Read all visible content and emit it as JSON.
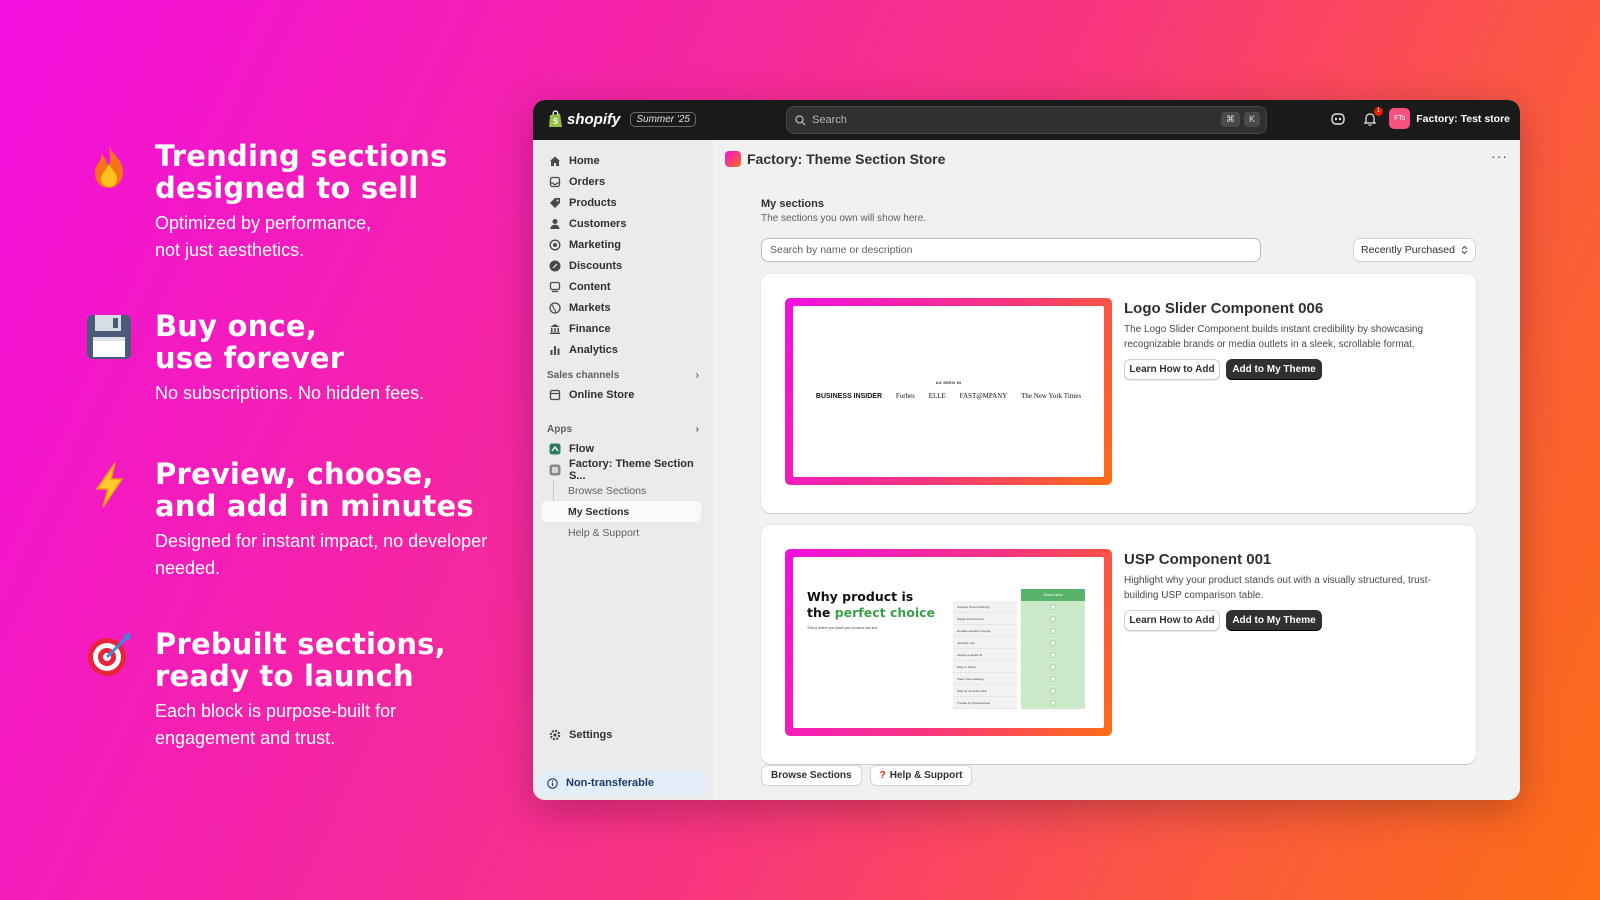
{
  "features": [
    {
      "icon": "fire-icon",
      "emoji": "🔥",
      "title_line1": "Trending sections",
      "title_line2": "designed to sell",
      "body_line1": "Optimized by performance,",
      "body_line2": "not just aesthetics."
    },
    {
      "icon": "floppy-disk-icon",
      "emoji": "💾",
      "title_line1": "Buy once,",
      "title_line2": "use forever",
      "body_line1": "No subscriptions. No hidden fees.",
      "body_line2": ""
    },
    {
      "icon": "lightning-icon",
      "emoji": "⚡",
      "title_line1": "Preview, choose,",
      "title_line2": "and add in minutes",
      "body_line1": "Designed for instant impact, no developer",
      "body_line2": "needed."
    },
    {
      "icon": "target-icon",
      "emoji": "🎯",
      "title_line1": "Prebuilt sections,",
      "title_line2": "ready to launch",
      "body_line1": "Each block is purpose-built for",
      "body_line2": "engagement and trust."
    }
  ],
  "topbar": {
    "brand": "shopify",
    "edition": "Summer '25",
    "search_placeholder": "Search",
    "shortcut_keys": [
      "⌘",
      "K"
    ],
    "notification_count": "1",
    "store_initials": "FTs",
    "store_name": "Factory: Test store"
  },
  "sidebar": {
    "items": [
      {
        "label": "Home",
        "icon": "home-icon"
      },
      {
        "label": "Orders",
        "icon": "inbox-icon"
      },
      {
        "label": "Products",
        "icon": "tag-icon"
      },
      {
        "label": "Customers",
        "icon": "person-icon"
      },
      {
        "label": "Marketing",
        "icon": "target-icon"
      },
      {
        "label": "Discounts",
        "icon": "discount-icon"
      },
      {
        "label": "Content",
        "icon": "content-icon"
      },
      {
        "label": "Markets",
        "icon": "globe-icon"
      },
      {
        "label": "Finance",
        "icon": "bank-icon"
      },
      {
        "label": "Analytics",
        "icon": "bar-chart-icon"
      }
    ],
    "sales_channels_label": "Sales channels",
    "online_store": "Online Store",
    "apps_label": "Apps",
    "flow": "Flow",
    "app_name": "Factory: Theme Section S...",
    "sub_items": [
      "Browse Sections",
      "My Sections",
      "Help & Support"
    ],
    "settings": "Settings",
    "non_transferable": "Non-transferable"
  },
  "main": {
    "page_title": "Factory: Theme Section Store",
    "more": "···",
    "section_title": "My sections",
    "section_subtitle": "The sections you own will show here.",
    "filter_placeholder": "Search by name or description",
    "sort_label": "Recently Purchased",
    "cards": [
      {
        "title": "Logo Slider Component 006",
        "description": "The Logo Slider Component builds instant credibility by showcasing recognizable brands or media outlets in a sleek, scrollable format.",
        "learn_label": "Learn How to Add",
        "add_label": "Add to My Theme",
        "preview": {
          "as_seen_in": "AS SEEN IN",
          "logos": [
            "BUSINESS INSIDER",
            "Forbes",
            "ELLE",
            "FAST@MPANY",
            "The New York Times"
          ]
        }
      },
      {
        "title": "USP Component 001",
        "description": "Highlight why your product stands out with a visually structured, trust-building USP comparison table.",
        "learn_label": "Learn How to Add",
        "add_label": "Add to My Theme",
        "preview": {
          "headline_line1": "Why product is",
          "headline_line2_prefix": "the ",
          "headline_highlight": "perfect choice",
          "small_text": "This is where you place your product sub text.",
          "column_header": "Brand name",
          "rows": [
            "Superior Sound Filtering",
            "Stylish and Discreet",
            "Durable and Eco Friendly",
            "Versatile Use",
            "Always a perfect fit",
            "Easy to Clean",
            "Clear Voice Hearing",
            "Safe for Sensitive Skin",
            "Trusted by Professionals"
          ]
        }
      }
    ],
    "bottom_buttons": {
      "browse": "Browse Sections",
      "help_prefix": "?",
      "help": "Help & Support"
    }
  },
  "colors": {
    "gradient_start": "#f20fe0",
    "gradient_end": "#fd6d15",
    "topbar": "#1a1a1a",
    "primary_button": "#303030",
    "usp_green": "#3aa14a"
  }
}
